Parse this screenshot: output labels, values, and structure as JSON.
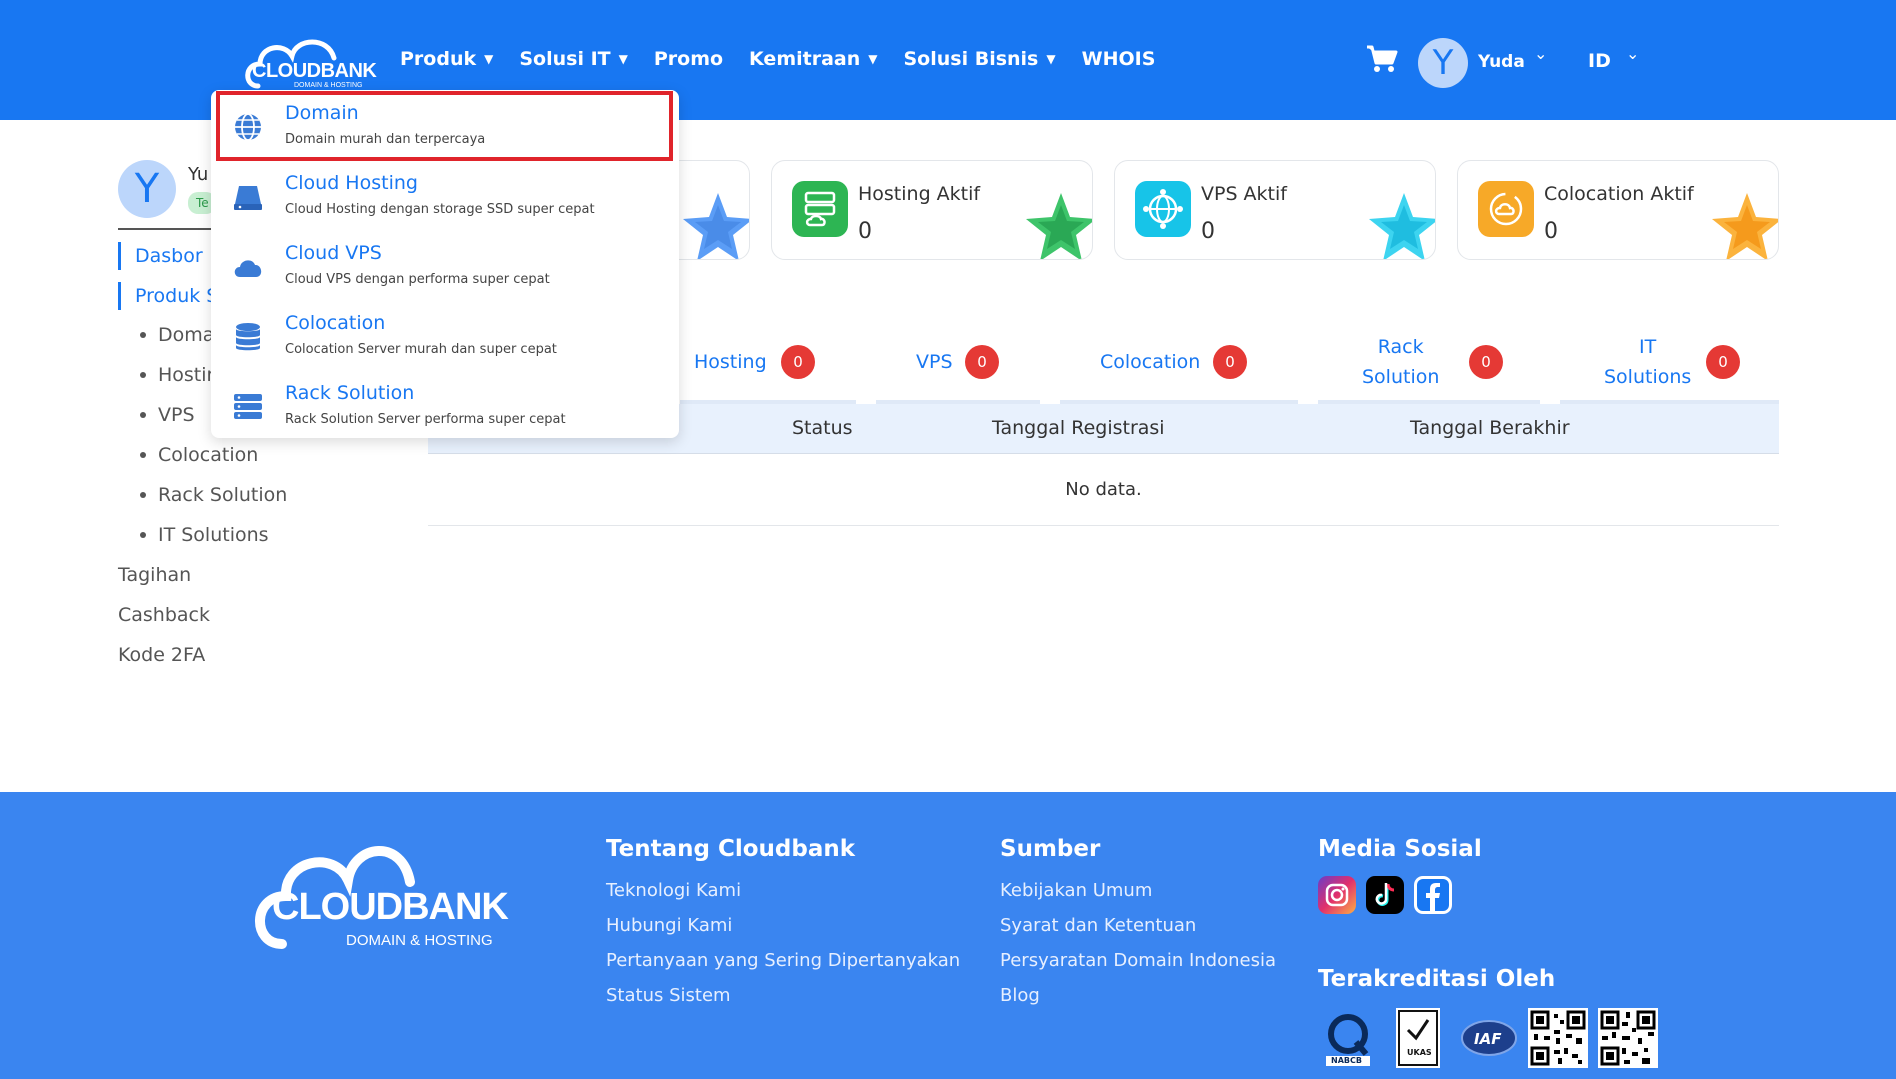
{
  "header": {
    "logo_text": "CLOUDBANK",
    "logo_sub": "DOMAIN & HOSTING",
    "nav": [
      {
        "label": "Produk",
        "caret": "▼"
      },
      {
        "label": "Solusi IT",
        "caret": "▼"
      },
      {
        "label": "Promo",
        "caret": ""
      },
      {
        "label": "Kemitraan",
        "caret": "▼"
      },
      {
        "label": "Solusi Bisnis",
        "caret": "▼"
      },
      {
        "label": "WHOIS",
        "caret": ""
      }
    ],
    "avatar_letter": "Y",
    "username": "Yuda",
    "language": "ID",
    "chevron": "⌄",
    "colors": {
      "primary": "#1877f2"
    }
  },
  "dropdown": {
    "items": [
      {
        "title": "Domain",
        "desc": "Domain murah dan terpercaya",
        "icon": "globe-icon"
      },
      {
        "title": "Cloud Hosting",
        "desc": "Cloud Hosting dengan storage SSD super cepat",
        "icon": "server-icon"
      },
      {
        "title": "Cloud VPS",
        "desc": "Cloud VPS dengan performa super cepat",
        "icon": "cloud-icon"
      },
      {
        "title": "Colocation",
        "desc": "Colocation Server murah dan super cepat",
        "icon": "database-icon"
      },
      {
        "title": "Rack Solution",
        "desc": "Rack Solution Server performa super cepat",
        "icon": "rack-icon"
      }
    ],
    "highlight_color": "#e0242b"
  },
  "sidebar": {
    "avatar_letter": "Y",
    "name": "Yu",
    "badge": "Te",
    "main": [
      {
        "label": "Dasbor"
      },
      {
        "label": "Produk S"
      }
    ],
    "sub": [
      {
        "label": "Doma"
      },
      {
        "label": "Hostir"
      },
      {
        "label": "VPS"
      },
      {
        "label": "Colocation"
      },
      {
        "label": "Rack Solution"
      },
      {
        "label": "IT Solutions"
      }
    ],
    "plain": [
      {
        "label": "Tagihan"
      },
      {
        "label": "Cashback"
      },
      {
        "label": "Kode 2FA"
      }
    ]
  },
  "cards": [
    {
      "title": "Hosting Aktif",
      "value": "0",
      "color": "#2db553",
      "icon": "server-stack-icon"
    },
    {
      "title": "VPS Aktif",
      "value": "0",
      "color": "#17c4e8",
      "icon": "network-globe-icon"
    },
    {
      "title": "Colocation Aktif",
      "value": "0",
      "color": "#f7a928",
      "icon": "cloud-settings-icon"
    }
  ],
  "tabs": [
    {
      "label": "Hosting",
      "count": "0"
    },
    {
      "label": "VPS",
      "count": "0"
    },
    {
      "label": "Colocation",
      "count": "0"
    },
    {
      "label_1": "Rack",
      "label_2": "Solution",
      "count": "0"
    },
    {
      "label_1": "IT",
      "label_2": "Solutions",
      "count": "0"
    }
  ],
  "table": {
    "columns": [
      "Status",
      "Tanggal Registrasi",
      "Tanggal Berakhir"
    ],
    "empty_text": "No data."
  },
  "footer": {
    "logo_text": "CLOUDBANK",
    "logo_sub": "DOMAIN & HOSTING",
    "about": {
      "heading": "Tentang Cloudbank",
      "links": [
        "Teknologi Kami",
        "Hubungi Kami",
        "Pertanyaan yang Sering Dipertanyakan",
        "Status Sistem"
      ]
    },
    "sources": {
      "heading": "Sumber",
      "links": [
        "Kebijakan Umum",
        "Syarat dan Ketentuan",
        "Persyaratan Domain Indonesia",
        "Blog"
      ]
    },
    "social": {
      "heading": "Media Sosial",
      "items": [
        "instagram-icon",
        "tiktok-icon",
        "facebook-icon"
      ]
    },
    "accredited": {
      "heading": "Terakreditasi Oleh",
      "logos": [
        {
          "name": "NABCB",
          "label": "NABCB"
        },
        {
          "name": "UKAS",
          "label": "UKAS"
        },
        {
          "name": "IAF",
          "label": "IAF"
        },
        {
          "name": "qr-code-1",
          "label": ""
        },
        {
          "name": "qr-code-2",
          "label": ""
        }
      ]
    }
  }
}
